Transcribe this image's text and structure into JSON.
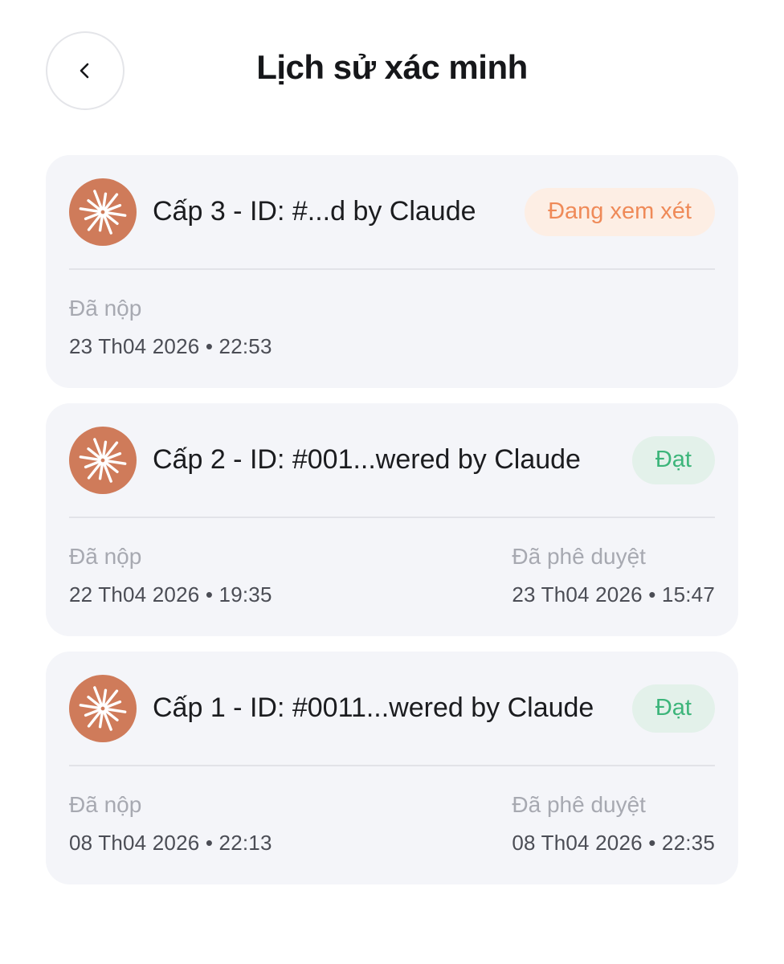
{
  "header": {
    "title": "Lịch sử xác minh",
    "back_icon": "chevron-left-icon"
  },
  "records": [
    {
      "title": "Cấp 3 - ID: #...d by Claude",
      "status": "Đang xem xét",
      "status_type": "review",
      "submitted_label": "Đã nộp",
      "submitted_value": "23 Th04 2026 • 22:53"
    },
    {
      "title": "Cấp 2 - ID: #001...wered by Claude",
      "status": "Đạt",
      "status_type": "pass",
      "submitted_label": "Đã nộp",
      "submitted_value": "22 Th04 2026 • 19:35",
      "approved_label": "Đã phê duyệt",
      "approved_value": "23 Th04 2026 • 15:47"
    },
    {
      "title": "Cấp 1 - ID: #0011...wered by Claude",
      "status": "Đạt",
      "status_type": "pass",
      "submitted_label": "Đã nộp",
      "submitted_value": "08 Th04 2026 • 22:13",
      "approved_label": "Đã phê duyệt",
      "approved_value": "08 Th04 2026 • 22:35"
    }
  ],
  "colors": {
    "avatar": "#cf7b5a",
    "review_text": "#ef8a58",
    "review_bg": "#fdeee4",
    "pass_text": "#3cb57a",
    "pass_bg": "#e3f1ea",
    "card_bg": "#f4f5f9"
  }
}
